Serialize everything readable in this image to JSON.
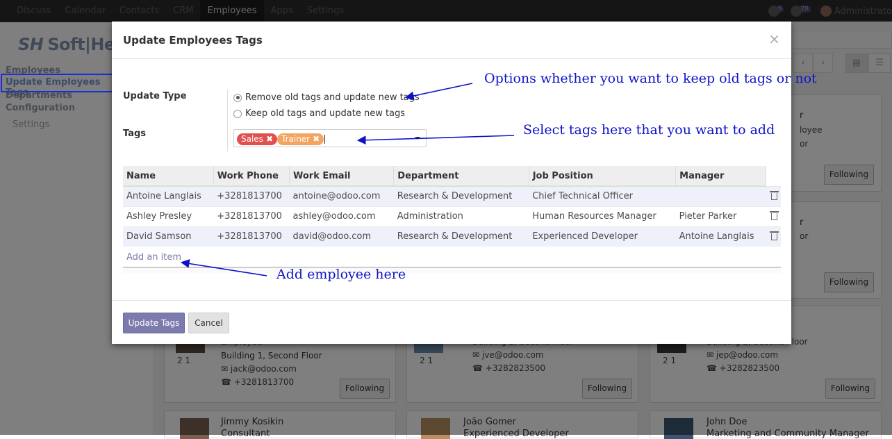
{
  "topbar": {
    "menu": [
      "Discuss",
      "Calendar",
      "Contacts",
      "CRM",
      "Employees",
      "Apps",
      "Settings"
    ],
    "active_index": 4,
    "systray": {
      "messages_badge": "6",
      "activity_badge": "20",
      "username": "Administrato"
    }
  },
  "logo": {
    "mark": "SH",
    "text": "Soft|Hea"
  },
  "leftnav": {
    "employees": "Employees",
    "update_tags": "Update Employees Tags",
    "departments": "Departments",
    "configuration": "Configuration",
    "settings": "Settings"
  },
  "background_cards": {
    "follow_label": "Following",
    "row1": [
      {
        "line1": "r",
        "line2": "loyee",
        "line3": "or"
      }
    ],
    "row3": [
      {
        "name": "Employee",
        "addr": "Building 1, Second Floor",
        "email": "jack@odoo.com",
        "phone": "+3281813700",
        "counts": "2  1"
      },
      {
        "name": "",
        "addr": "Building 2, Second Floor",
        "email": "jve@odoo.com",
        "phone": "+3282823500",
        "counts": "2  1"
      },
      {
        "name": "",
        "addr": "Building 2, Second Floor",
        "email": "jep@odoo.com",
        "phone": "+3282823500",
        "counts": "2  1"
      }
    ],
    "row4": [
      {
        "name": "Jimmy Kosikin",
        "title": "Consultant"
      },
      {
        "name": "João Gomer",
        "title": "Experienced Developer"
      },
      {
        "name": "John Doe",
        "title": "Marketing and Community Manager"
      }
    ]
  },
  "modal": {
    "title": "Update Employees Tags",
    "close": "×",
    "update_type_label": "Update Type",
    "options": [
      "Remove old tags and update new tags",
      "Keep old tags and update new tags"
    ],
    "selected_option": 0,
    "tags_label": "Tags",
    "tags": [
      {
        "label": "Sales",
        "color": "#e0504f"
      },
      {
        "label": "Trainer",
        "color": "#f4a460"
      }
    ],
    "table": {
      "columns": [
        "Name",
        "Work Phone",
        "Work Email",
        "Department",
        "Job Position",
        "Manager"
      ],
      "rows": [
        [
          "Antoine Langlais",
          "+3281813700",
          "antoine@odoo.com",
          "Research & Development",
          "Chief Technical Officer",
          ""
        ],
        [
          "Ashley Presley",
          "+3281813700",
          "ashley@odoo.com",
          "Administration",
          "Human Resources Manager",
          "Pieter Parker"
        ],
        [
          "David Samson",
          "+3281813700",
          "david@odoo.com",
          "Research & Development",
          "Experienced Developer",
          "Antoine Langlais"
        ]
      ],
      "add_item": "Add an item"
    },
    "buttons": {
      "primary": "Update Tags",
      "secondary": "Cancel"
    }
  },
  "annotations": {
    "options": "Options whether you want to keep old tags or not",
    "tags": "Select tags here that you want to add",
    "add": "Add employee here"
  }
}
